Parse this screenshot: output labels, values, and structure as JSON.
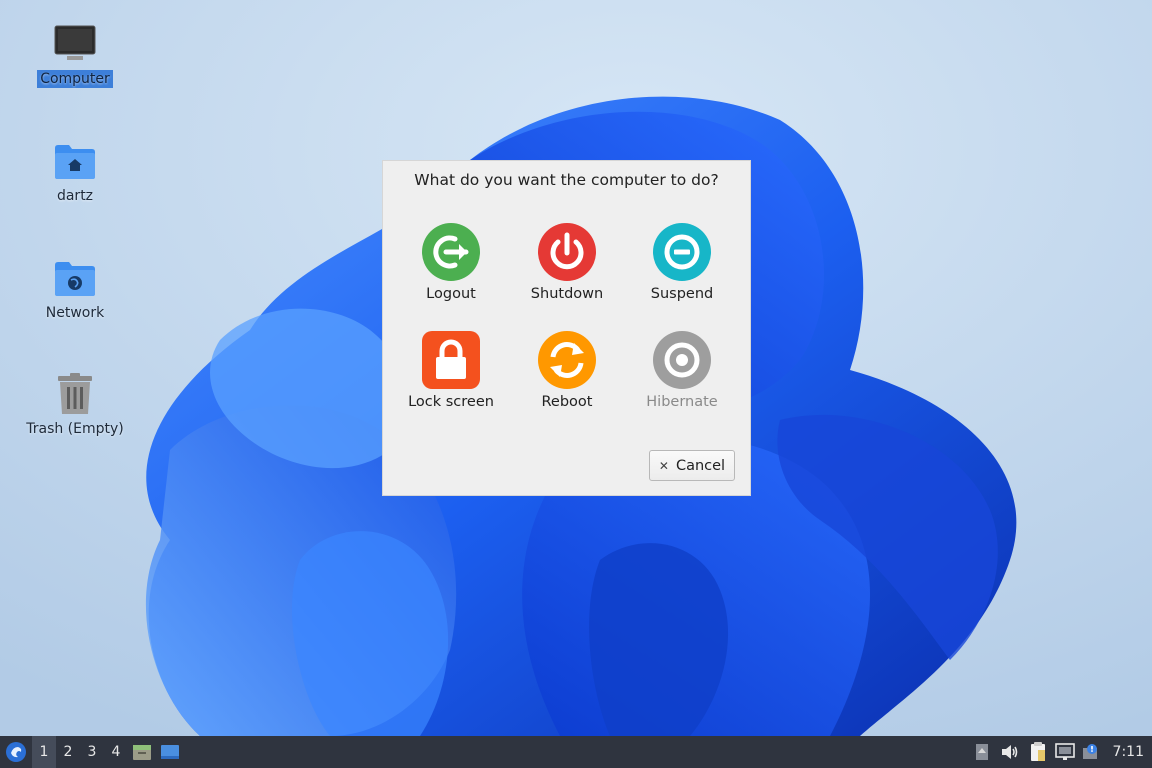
{
  "desktop": {
    "icons": [
      {
        "label": "Computer",
        "icon": "computer-icon"
      },
      {
        "label": "dartz",
        "icon": "home-folder-icon"
      },
      {
        "label": "Network",
        "icon": "network-folder-icon"
      },
      {
        "label": "Trash (Empty)",
        "icon": "trash-icon"
      }
    ]
  },
  "dialog": {
    "title": "What do you want the computer to do?",
    "options": [
      {
        "label": "Logout",
        "icon": "logout-icon",
        "color": "#4caf50"
      },
      {
        "label": "Shutdown",
        "icon": "power-icon",
        "color": "#e53935"
      },
      {
        "label": "Suspend",
        "icon": "suspend-icon",
        "color": "#17b6c8"
      },
      {
        "label": "Lock screen",
        "icon": "lock-icon",
        "color": "#f4511e"
      },
      {
        "label": "Reboot",
        "icon": "reboot-icon",
        "color": "#ff9800"
      },
      {
        "label": "Hibernate",
        "icon": "hibernate-icon",
        "color": "#9e9e9e"
      }
    ],
    "cancel_label": "Cancel"
  },
  "taskbar": {
    "workspaces": [
      "1",
      "2",
      "3",
      "4"
    ],
    "clock": "7:11"
  }
}
